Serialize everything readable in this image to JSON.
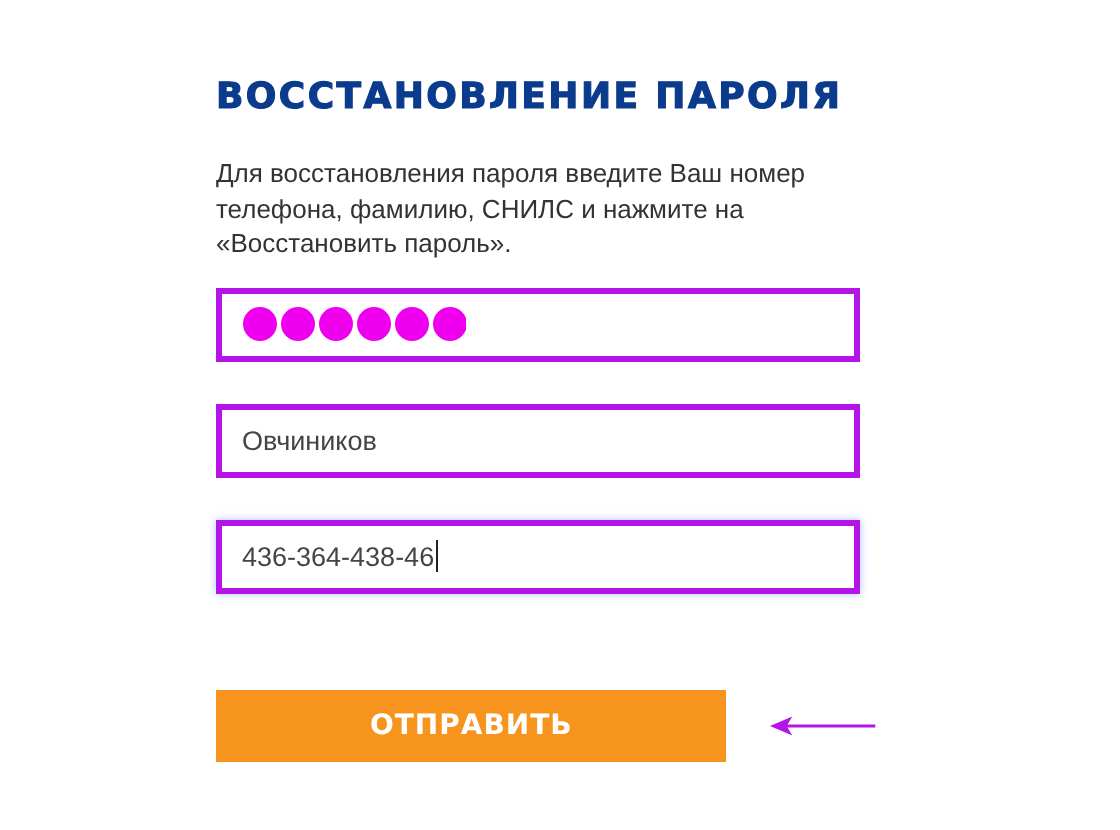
{
  "title": "ВОССТАНОВЛЕНИЕ ПАРОЛЯ",
  "description": "Для восстановления пароля введите Ваш номер телефона, фамилию, СНИЛС и нажмите на «Восстановить пароль».",
  "fields": [
    {
      "kind": "redacted",
      "focused": false
    },
    {
      "kind": "text",
      "value": "Овчиников",
      "focused": false
    },
    {
      "kind": "text",
      "value": "436-364-438-46",
      "focused": true
    }
  ],
  "submit_button": {
    "label": "ОТПРАВИТЬ"
  }
}
